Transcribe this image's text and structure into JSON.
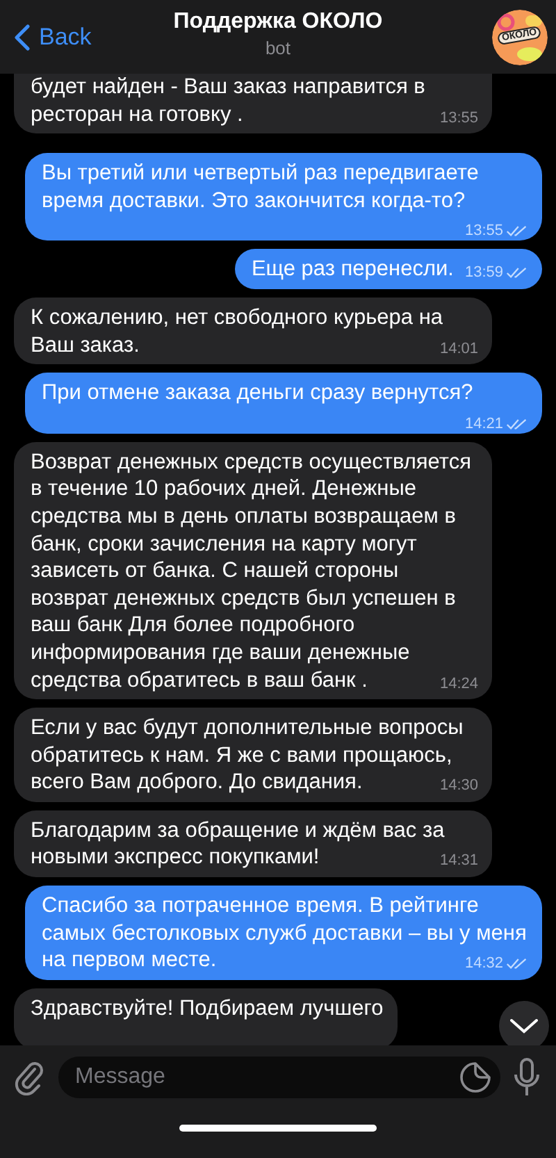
{
  "header": {
    "back": "Back",
    "title": "Поддержка ОКОЛО",
    "subtitle": "bot",
    "avatar_text": "ОКОЛО"
  },
  "messages": [
    {
      "kind": "incoming",
      "text": "будет найден - Ваш заказ направится в ресторан на готовку .",
      "time": "13:55"
    },
    {
      "kind": "outgoing",
      "text": "Вы третий или четвертый раз передвигаете время доставки. Это закончится когда-то?",
      "time": "13:55",
      "read": true
    },
    {
      "kind": "outgoing",
      "text": "Еще раз перенесли.",
      "time": "13:59",
      "read": true
    },
    {
      "kind": "incoming",
      "text": "К сожалению, нет свободного курьера на Ваш заказ.",
      "time": "14:01"
    },
    {
      "kind": "outgoing",
      "text": "При отмене заказа деньги сразу вернутся?",
      "time": "14:21",
      "read": true
    },
    {
      "kind": "incoming",
      "text": "Возврат денежных средств осуществляется в течение 10 рабочих дней. Денежные средства мы в день оплаты возвращаем в банк, сроки зачисления на карту могут зависеть от банка. С нашей стороны возврат денежных средств был успешен в ваш банк  Для более подробного информирования где ваши денежные средства обратитесь в ваш банк .",
      "time": "14:24"
    },
    {
      "kind": "incoming",
      "text": "Если у вас будут дополнительные вопросы обратитесь к нам. Я же с вами прощаюсь, всего Вам доброго. До свидания.",
      "time": "14:30"
    },
    {
      "kind": "incoming",
      "text": "Благодарим за обращение и ждём вас за новыми экспресс покупками!",
      "time": "14:31"
    },
    {
      "kind": "outgoing",
      "text": "Спасибо за потраченное время. В рейтинге самых бестолковых служб доставки – вы у меня на первом месте.",
      "time": "14:32",
      "read": true
    },
    {
      "kind": "incoming",
      "text": "Здравствуйте! Подбираем лучшего"
    }
  ],
  "composer": {
    "placeholder": "Message"
  }
}
